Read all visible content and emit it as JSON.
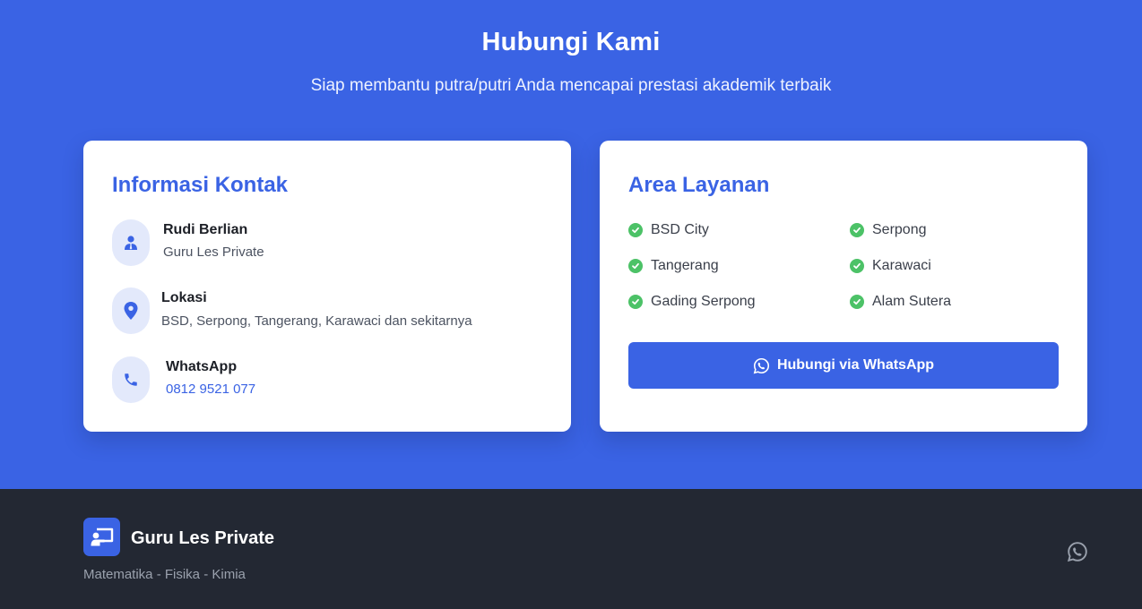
{
  "contact": {
    "title": "Hubungi Kami",
    "subtitle": "Siap membantu putra/putri Anda mencapai prestasi akademik terbaik"
  },
  "info_card": {
    "title": "Informasi Kontak",
    "items": [
      {
        "icon": "user-tie-icon",
        "label": "Rudi Berlian",
        "value": "Guru Les Private"
      },
      {
        "icon": "map-pin-icon",
        "label": "Lokasi",
        "value": "BSD, Serpong, Tangerang, Karawaci dan sekitarnya"
      },
      {
        "icon": "phone-icon",
        "label": "WhatsApp",
        "value": "0812 9521 077"
      }
    ]
  },
  "area_card": {
    "title": "Area Layanan",
    "areas": [
      "BSD City",
      "Serpong",
      "Tangerang",
      "Karawaci",
      "Gading Serpong",
      "Alam Sutera"
    ],
    "button_label": "Hubungi via WhatsApp",
    "button_icon": "whatsapp-icon"
  },
  "footer": {
    "logo_icon": "chalkboard-teacher-icon",
    "brand": "Guru Les Private",
    "tagline": "Matematika - Fisika - Kimia",
    "social_icon": "whatsapp-icon"
  },
  "colors": {
    "primary": "#3a63e4",
    "footer_bg": "#232833",
    "check_green": "#4cc267",
    "icon_bg": "#e3e9fb"
  }
}
